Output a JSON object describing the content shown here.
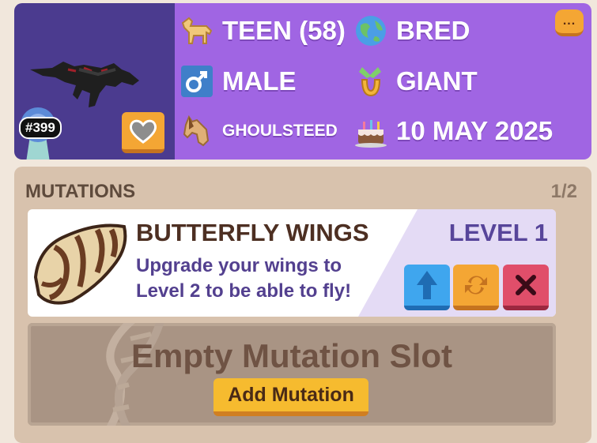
{
  "horse": {
    "id_badge": "#399",
    "age": "TEEN (58)",
    "origin": "BRED",
    "gender": "MALE",
    "size": "GIANT",
    "breed": "GHOULSTEED",
    "birthday": "10 MAY 2025",
    "more_label": "..."
  },
  "icons": {
    "age": "horse-icon",
    "origin": "globe-icon",
    "gender": "male-symbol-icon",
    "size": "horseshoe-icon",
    "breed": "horse-head-icon",
    "birthday": "birthday-cake-icon",
    "favorite": "heart-icon",
    "upgrade": "arrow-up-icon",
    "reroll": "reroll-icon",
    "remove": "close-icon"
  },
  "mutations": {
    "title": "MUTATIONS",
    "count": "1/2",
    "items": [
      {
        "name": "BUTTERFLY WINGS",
        "level": "LEVEL 1",
        "description": "Upgrade your wings to Level 2 to be able to fly!"
      }
    ],
    "empty_slot": {
      "label": "Empty Mutation Slot",
      "button": "Add Mutation"
    }
  },
  "colors": {
    "portrait_bg": "#4b3b8f",
    "info_bg": "#a065e3",
    "panel_bg": "#d8c2ad",
    "accent_orange": "#f4a634"
  }
}
